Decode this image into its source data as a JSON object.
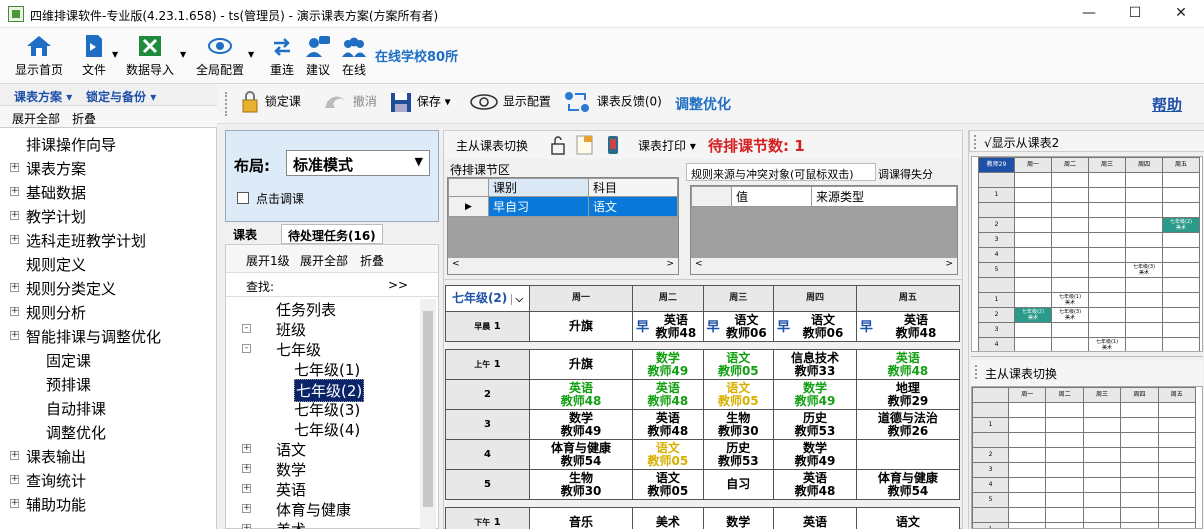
{
  "window": {
    "title": "四维排课软件-专业版(4.23.1.658) - ts(管理员) - 演示课表方案(方案所有者)",
    "min": "—",
    "max": "☐",
    "close": "✕"
  },
  "toolbar": {
    "items": [
      "显示首页",
      "文件",
      "数据导入",
      "全局配置",
      "重连",
      "建议",
      "在线"
    ],
    "online": "在线学校80所"
  },
  "left": {
    "menu1": "课表方案",
    "menu2": "锁定与备份",
    "expand": "展开全部",
    "collapse": "折叠",
    "tree": [
      {
        "t": "排课操作向导",
        "p": false,
        "ind": 0
      },
      {
        "t": "课表方案",
        "p": true,
        "ind": 0
      },
      {
        "t": "基础数据",
        "p": true,
        "ind": 0
      },
      {
        "t": "教学计划",
        "p": true,
        "ind": 0
      },
      {
        "t": "选科走班教学计划",
        "p": true,
        "ind": 0
      },
      {
        "t": "规则定义",
        "p": false,
        "ind": 0
      },
      {
        "t": "规则分类定义",
        "p": true,
        "ind": 0
      },
      {
        "t": "规则分析",
        "p": true,
        "ind": 0
      },
      {
        "t": "智能排课与调整优化",
        "p": true,
        "ind": 0
      },
      {
        "t": "固定课",
        "p": false,
        "ind": 1
      },
      {
        "t": "预排课",
        "p": false,
        "ind": 1
      },
      {
        "t": "自动排课",
        "p": false,
        "ind": 1
      },
      {
        "t": "调整优化",
        "p": false,
        "ind": 1
      },
      {
        "t": "课表输出",
        "p": true,
        "ind": 0
      },
      {
        "t": "查询统计",
        "p": true,
        "ind": 0
      },
      {
        "t": "辅助功能",
        "p": true,
        "ind": 0
      }
    ]
  },
  "actions": {
    "lock": "锁定课",
    "undo": "撤消",
    "save": "保存",
    "display": "显示配置",
    "feedback": "课表反馈(0)",
    "optimize": "调整优化",
    "help": "帮助"
  },
  "layout": {
    "label": "布局:",
    "mode": "标准模式",
    "check": "点击调课"
  },
  "tabs": {
    "t1": "课表",
    "t2": "待处理任务(16)"
  },
  "list": {
    "expand1": "展开1级",
    "expandAll": "展开全部",
    "collapse": "折叠",
    "search": "查找:",
    "more": ">>",
    "items": [
      {
        "t": "任务列表",
        "lv": 0,
        "b": ""
      },
      {
        "t": "班级",
        "lv": 0,
        "b": "-"
      },
      {
        "t": "七年级",
        "lv": 1,
        "b": "-"
      },
      {
        "t": "七年级(1)",
        "lv": 2,
        "b": ""
      },
      {
        "t": "七年级(2)",
        "lv": 2,
        "b": "",
        "sel": true
      },
      {
        "t": "七年级(3)",
        "lv": 2,
        "b": ""
      },
      {
        "t": "七年级(4)",
        "lv": 2,
        "b": ""
      },
      {
        "t": "语文",
        "lv": 1,
        "b": "+"
      },
      {
        "t": "数学",
        "lv": 1,
        "b": "+"
      },
      {
        "t": "英语",
        "lv": 1,
        "b": "+"
      },
      {
        "t": "体育与健康",
        "lv": 1,
        "b": "+"
      },
      {
        "t": "美术",
        "lv": 1,
        "b": "+"
      }
    ]
  },
  "mid": {
    "switch": "主从课表切换",
    "print": "课表打印",
    "pending": "待排课节数: 1",
    "pendingTitle": "待排课节区",
    "pendingHead": [
      "课别",
      "科目"
    ],
    "pendingRow": [
      "早自习",
      "语文"
    ],
    "ruleTab": "规则来源与冲突对象(可鼠标双击)",
    "ruleTab2": "调课得失分",
    "ruleHead": [
      "值",
      "来源类型"
    ],
    "classSel": "七年级(2)",
    "days": [
      "周一",
      "周二",
      "周三",
      "周四",
      "周五"
    ],
    "rows": [
      {
        "h": "早晨",
        "n": "1",
        "c": [
          [
            "升旗",
            "",
            ""
          ],
          [
            "英语",
            "教师48",
            "",
            "早"
          ],
          [
            "语文",
            "教师06",
            "",
            "早"
          ],
          [
            "语文",
            "教师06",
            "",
            "早"
          ],
          [
            "英语",
            "教师48",
            "",
            "早"
          ]
        ]
      },
      {
        "h": "上午",
        "n": "1",
        "c": [
          [
            "升旗",
            "",
            ""
          ],
          [
            "数学",
            "教师49",
            "g"
          ],
          [
            "语文",
            "教师05",
            "g"
          ],
          [
            "信息技术",
            "教师33",
            ""
          ],
          [
            "英语",
            "教师48",
            "g"
          ]
        ]
      },
      {
        "h": "",
        "n": "2",
        "c": [
          [
            "英语",
            "教师48",
            "g"
          ],
          [
            "英语",
            "教师48",
            "g"
          ],
          [
            "语文",
            "教师05",
            "y"
          ],
          [
            "数学",
            "教师49",
            "g"
          ],
          [
            "地理",
            "教师29",
            ""
          ]
        ]
      },
      {
        "h": "",
        "n": "3",
        "c": [
          [
            "数学",
            "教师49",
            ""
          ],
          [
            "英语",
            "教师48",
            ""
          ],
          [
            "生物",
            "教师30",
            ""
          ],
          [
            "历史",
            "教师53",
            ""
          ],
          [
            "道德与法治",
            "教师26",
            ""
          ]
        ]
      },
      {
        "h": "",
        "n": "4",
        "c": [
          [
            "体育与健康",
            "教师54",
            ""
          ],
          [
            "语文",
            "教师05",
            "y"
          ],
          [
            "历史",
            "教师53",
            ""
          ],
          [
            "数学",
            "教师49",
            ""
          ],
          [
            "",
            "",
            ""
          ]
        ]
      },
      {
        "h": "",
        "n": "5",
        "c": [
          [
            "生物",
            "教师30",
            ""
          ],
          [
            "语文",
            "教师05",
            ""
          ],
          [
            "自习",
            "",
            ""
          ],
          [
            "英语",
            "教师48",
            ""
          ],
          [
            "体育与健康",
            "教师54",
            ""
          ]
        ]
      },
      {
        "h": "下午",
        "n": "1",
        "c": [
          [
            "音乐",
            "",
            ""
          ],
          [
            "美术",
            "",
            ""
          ],
          [
            "数学",
            "",
            ""
          ],
          [
            "英语",
            "",
            ""
          ],
          [
            "语文",
            "",
            ""
          ]
        ]
      }
    ]
  },
  "right": {
    "title": "√显示从课表2",
    "switch": "主从课表切换",
    "days": [
      "周一",
      "周二",
      "周三",
      "周四",
      "周五"
    ],
    "corner": "教师29",
    "r1": "早晨",
    "r2": "上午",
    "r3": "下午",
    "cell1": "七年级(2)",
    "cell2": "七年级(3)",
    "cell3": "七年级(1)",
    "cell4": "七年级(3)",
    "cell5": "七年级(1)",
    "sub": "美术"
  }
}
